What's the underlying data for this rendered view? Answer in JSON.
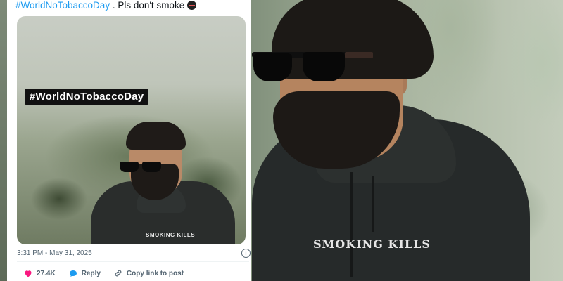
{
  "tweet": {
    "hashtag": "#WorldNoTobaccoDay",
    "text": " . Pls don't smoke",
    "emoji": "no-smoking-emoji",
    "image_tag": "#WorldNoTobaccoDay",
    "image_shirt_text": "SMOKING KILLS",
    "timestamp": "3:31 PM - May 31, 2025",
    "likes": "27.4K",
    "reply_label": "Reply",
    "copy_link_label": "Copy link to post"
  },
  "photo": {
    "shirt_text": "SMOKING KILLS"
  },
  "colors": {
    "hashtag": "#1d9bf0",
    "like": "#f91880",
    "reply": "#1d9bf0",
    "muted": "#536471"
  }
}
